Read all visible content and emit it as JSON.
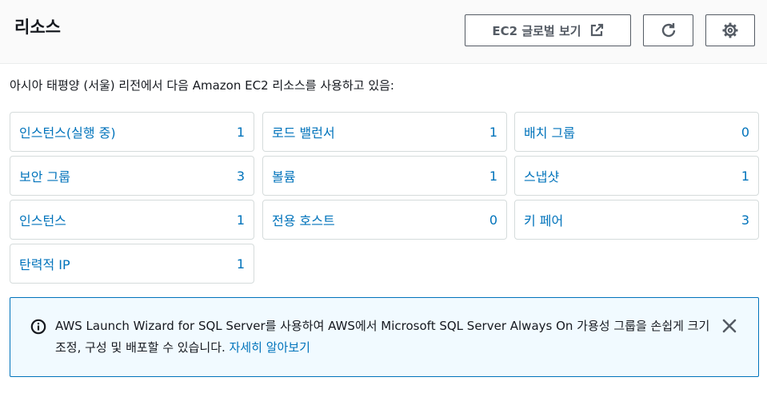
{
  "header": {
    "title": "리소스",
    "ec2_button_label": "EC2 글로벌 보기",
    "ec2_button_icon": "external-link-icon",
    "refresh_icon": "refresh-icon",
    "settings_icon": "gear-icon"
  },
  "description": "아시아 태평양 (서울) 리전에서 다음 Amazon EC2 리소스를 사용하고 있음:",
  "resources": [
    {
      "label": "인스턴스(실행 중)",
      "count": "1"
    },
    {
      "label": "로드 밸런서",
      "count": "1"
    },
    {
      "label": "배치 그룹",
      "count": "0"
    },
    {
      "label": "보안 그룹",
      "count": "3"
    },
    {
      "label": "볼륨",
      "count": "1"
    },
    {
      "label": "스냅샷",
      "count": "1"
    },
    {
      "label": "인스턴스",
      "count": "1"
    },
    {
      "label": "전용 호스트",
      "count": "0"
    },
    {
      "label": "키 페어",
      "count": "3"
    },
    {
      "label": "탄력적 IP",
      "count": "1"
    }
  ],
  "flash": {
    "message": "AWS Launch Wizard for SQL Server를 사용하여 AWS에서 Microsoft SQL Server Always On 가용성 그룹을 손쉽게 크기 조정, 구성 및 배포할 수 있습니다. ",
    "link_text": "자세히 알아보기",
    "icon": "info-icon",
    "close_icon": "close-icon"
  },
  "colors": {
    "link": "#0073bb",
    "text": "#16191f",
    "button_border": "#545b64",
    "info_bg": "#f1faff"
  }
}
